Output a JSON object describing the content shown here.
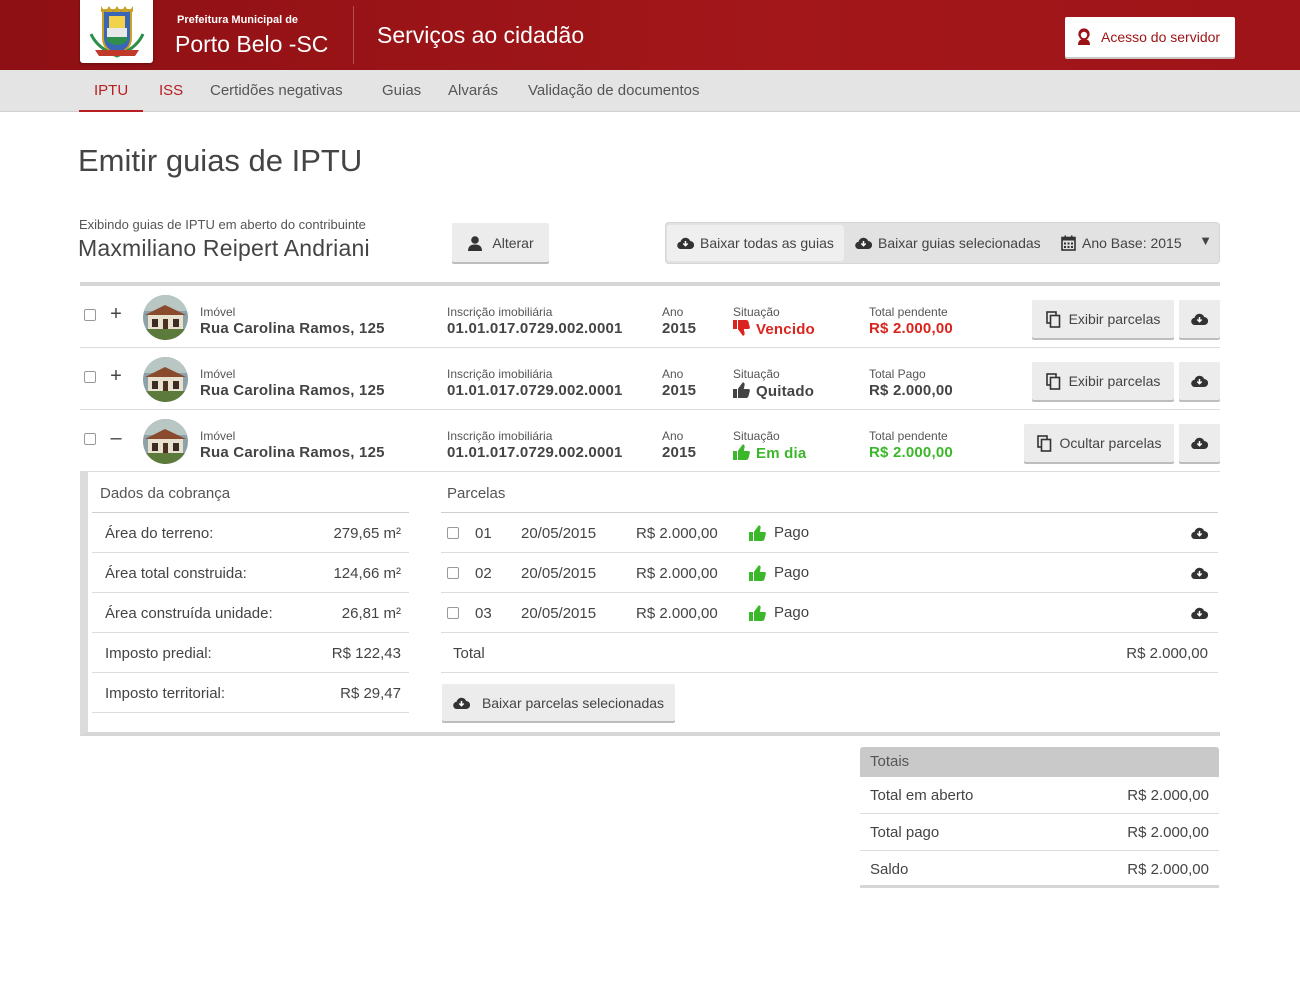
{
  "header": {
    "org_small": "Prefeitura Municipal de",
    "org_big": "Porto Belo -SC",
    "title": "Serviços ao cidadão",
    "servidor_button": "Acesso do servidor"
  },
  "nav": {
    "items": [
      {
        "label": "IPTU"
      },
      {
        "label": "ISS"
      },
      {
        "label": "Certidões negativas"
      },
      {
        "label": "Guias"
      },
      {
        "label": "Alvarás"
      },
      {
        "label": "Validação de documentos"
      }
    ]
  },
  "page": {
    "title": "Emitir guias de IPTU",
    "contributor_label": "Exibindo guias de IPTU em aberto do contribuinte",
    "contributor_name": "Maxmiliano Reipert Andriani",
    "alterar_button": "Alterar"
  },
  "toolbar": {
    "download_all": "Baixar todas as guias",
    "download_selected": "Baixar guias selecionadas",
    "year_base": "Ano Base: 2015"
  },
  "rows": [
    {
      "expand": "+",
      "imovel_label": "Imóvel",
      "imovel": "Rua Carolina Ramos, 125",
      "inscricao_label": "Inscrição imobiliária",
      "inscricao": "01.01.017.0729.002.0001",
      "ano_label": "Ano",
      "ano": "2015",
      "situacao_label": "Situação",
      "situacao": "Vencido",
      "total_label": "Total pendente",
      "total": "R$ 2.000,00",
      "action": "Exibir parcelas"
    },
    {
      "expand": "+",
      "imovel_label": "Imóvel",
      "imovel": "Rua Carolina Ramos, 125",
      "inscricao_label": "Inscrição imobiliária",
      "inscricao": "01.01.017.0729.002.0001",
      "ano_label": "Ano",
      "ano": "2015",
      "situacao_label": "Situação",
      "situacao": "Quitado",
      "total_label": "Total Pago",
      "total": "R$ 2.000,00",
      "action": "Exibir parcelas"
    },
    {
      "expand": "–",
      "imovel_label": "Imóvel",
      "imovel": "Rua Carolina Ramos, 125",
      "inscricao_label": "Inscrição imobiliária",
      "inscricao": "01.01.017.0729.002.0001",
      "ano_label": "Ano",
      "ano": "2015",
      "situacao_label": "Situação",
      "situacao": "Em dia",
      "total_label": "Total pendente",
      "total": "R$ 2.000,00",
      "action": "Ocultar parcelas"
    }
  ],
  "cobranca": {
    "title": "Dados da cobrança",
    "items": [
      {
        "label": "Área do terreno:",
        "value": "279,65 m²"
      },
      {
        "label": "Área total construida:",
        "value": "124,66 m²"
      },
      {
        "label": "Área construída unidade:",
        "value": "26,81 m²"
      },
      {
        "label": "Imposto predial:",
        "value": "R$ 122,43"
      },
      {
        "label": "Imposto territorial:",
        "value": "R$ 29,47"
      }
    ]
  },
  "parcelas": {
    "title": "Parcelas",
    "items": [
      {
        "num": "01",
        "date": "20/05/2015",
        "value": "R$ 2.000,00",
        "status": "Pago"
      },
      {
        "num": "02",
        "date": "20/05/2015",
        "value": "R$ 2.000,00",
        "status": "Pago"
      },
      {
        "num": "03",
        "date": "20/05/2015",
        "value": "R$ 2.000,00",
        "status": "Pago"
      }
    ],
    "total_label": "Total",
    "total_value": "R$ 2.000,00",
    "download_selected": "Baixar parcelas selecionadas"
  },
  "totais": {
    "title": "Totais",
    "items": [
      {
        "label": "Total em aberto",
        "value": "R$ 2.000,00"
      },
      {
        "label": "Total pago",
        "value": "R$ 2.000,00"
      },
      {
        "label": "Saldo",
        "value": "R$ 2.000,00"
      }
    ]
  },
  "colors": {
    "brand": "#9c1316",
    "danger": "#d9251d",
    "success": "#3bb82a"
  }
}
